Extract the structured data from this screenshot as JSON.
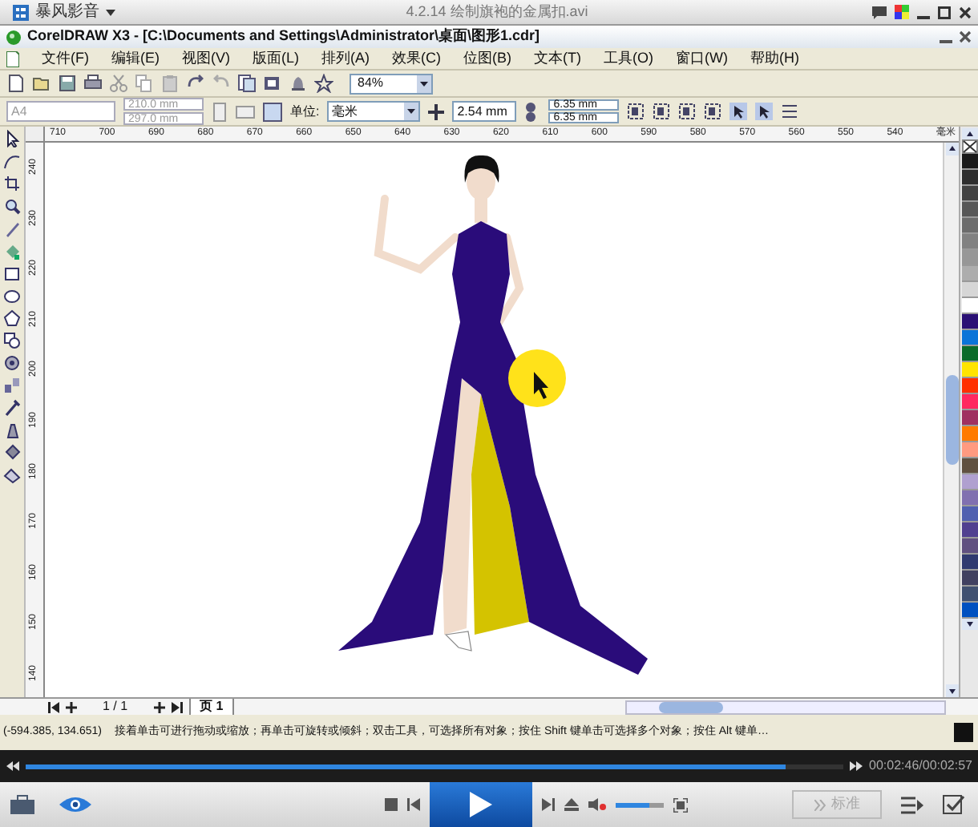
{
  "player": {
    "app_menu": "暴风影音",
    "title": "4.2.14 绘制旗袍的金属扣.avi"
  },
  "window": {
    "title": "CorelDRAW X3 - [C:\\Documents and Settings\\Administrator\\桌面\\图形1.cdr]"
  },
  "menu": [
    "文件(F)",
    "编辑(E)",
    "视图(V)",
    "版面(L)",
    "排列(A)",
    "效果(C)",
    "位图(B)",
    "文本(T)",
    "工具(O)",
    "窗口(W)",
    "帮助(H)"
  ],
  "toolbar": {
    "zoom": "84%"
  },
  "property_bar": {
    "paper": "A4",
    "width": "210.0 mm",
    "height": "297.0 mm",
    "unit_label": "单位:",
    "unit": "毫米",
    "nudge": "2.54 mm",
    "dup_x": "6.35 mm",
    "dup_y": "6.35 mm"
  },
  "ruler": {
    "h_ticks": [
      "710",
      "700",
      "690",
      "680",
      "670",
      "660",
      "650",
      "640",
      "630",
      "620",
      "610",
      "600",
      "590",
      "580",
      "570",
      "560",
      "550",
      "540"
    ],
    "unit": "毫米",
    "v_ticks": [
      "240",
      "230",
      "220",
      "210",
      "200",
      "190",
      "180",
      "170",
      "160",
      "150",
      "140"
    ]
  },
  "palette": [
    {
      "color": "#1a1a1a"
    },
    {
      "color": "#2e2e2e"
    },
    {
      "color": "#424242"
    },
    {
      "color": "#575757"
    },
    {
      "color": "#6c6c6c"
    },
    {
      "color": "#818181"
    },
    {
      "color": "#979797"
    },
    {
      "color": "#adadad"
    },
    {
      "color": "#d6d6d6"
    },
    {
      "color": "#ffffff"
    },
    {
      "color": "#2a1075"
    },
    {
      "color": "#0a74d8"
    },
    {
      "color": "#0a6b2a"
    },
    {
      "color": "#ffe400"
    },
    {
      "color": "#ff3000"
    },
    {
      "color": "#ff2860"
    },
    {
      "color": "#a03060"
    },
    {
      "color": "#ff7a00"
    },
    {
      "color": "#ff9a80"
    },
    {
      "color": "#605040"
    },
    {
      "color": "#b0a0d0"
    },
    {
      "color": "#8070b0"
    },
    {
      "color": "#5060b0"
    },
    {
      "color": "#504090"
    },
    {
      "color": "#605080"
    },
    {
      "color": "#303a70"
    },
    {
      "color": "#404060"
    },
    {
      "color": "#405070"
    },
    {
      "color": "#0050c0"
    }
  ],
  "page_nav": {
    "count": "1 / 1",
    "tab": "页 1"
  },
  "status_bar": {
    "coords": "(-594.385, 134.651)",
    "hint": "接着单击可进行拖动或缩放；再单击可旋转或倾斜；双击工具，可选择所有对象；按住 Shift 键单击可选择多个对象；按住 Alt 键单…"
  },
  "playback": {
    "level": 0.93,
    "time": "00:02:46/00:02:57",
    "volume": {
      "level": 0.7
    },
    "quality_button": "标准"
  }
}
